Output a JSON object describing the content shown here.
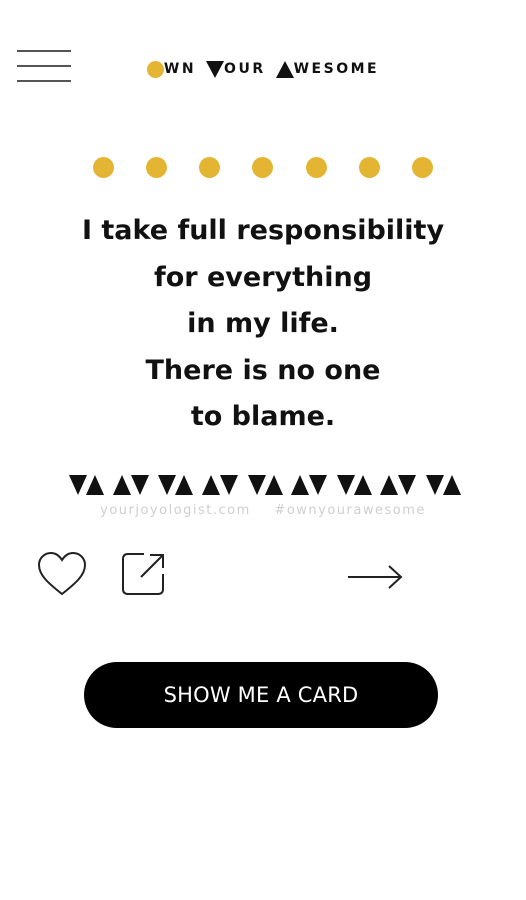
{
  "header": {
    "menu_icon": "hamburger-menu-icon",
    "logo": {
      "words": [
        "WN",
        "OUR",
        "WESOME"
      ],
      "accent_color": "#e3b533"
    }
  },
  "card": {
    "decor_dots_color": "#e3b533",
    "lines": [
      "I take full responsibility",
      "for everything",
      "in my life.",
      "There is no one",
      "to blame."
    ],
    "watermark": {
      "site": "yourjoyologist.com",
      "hashtag": "#ownyourawesome"
    }
  },
  "actions": {
    "like_icon": "heart-icon",
    "share_icon": "share-external-icon",
    "next_icon": "arrow-right-icon"
  },
  "cta": {
    "label": "SHOW ME A CARD"
  }
}
